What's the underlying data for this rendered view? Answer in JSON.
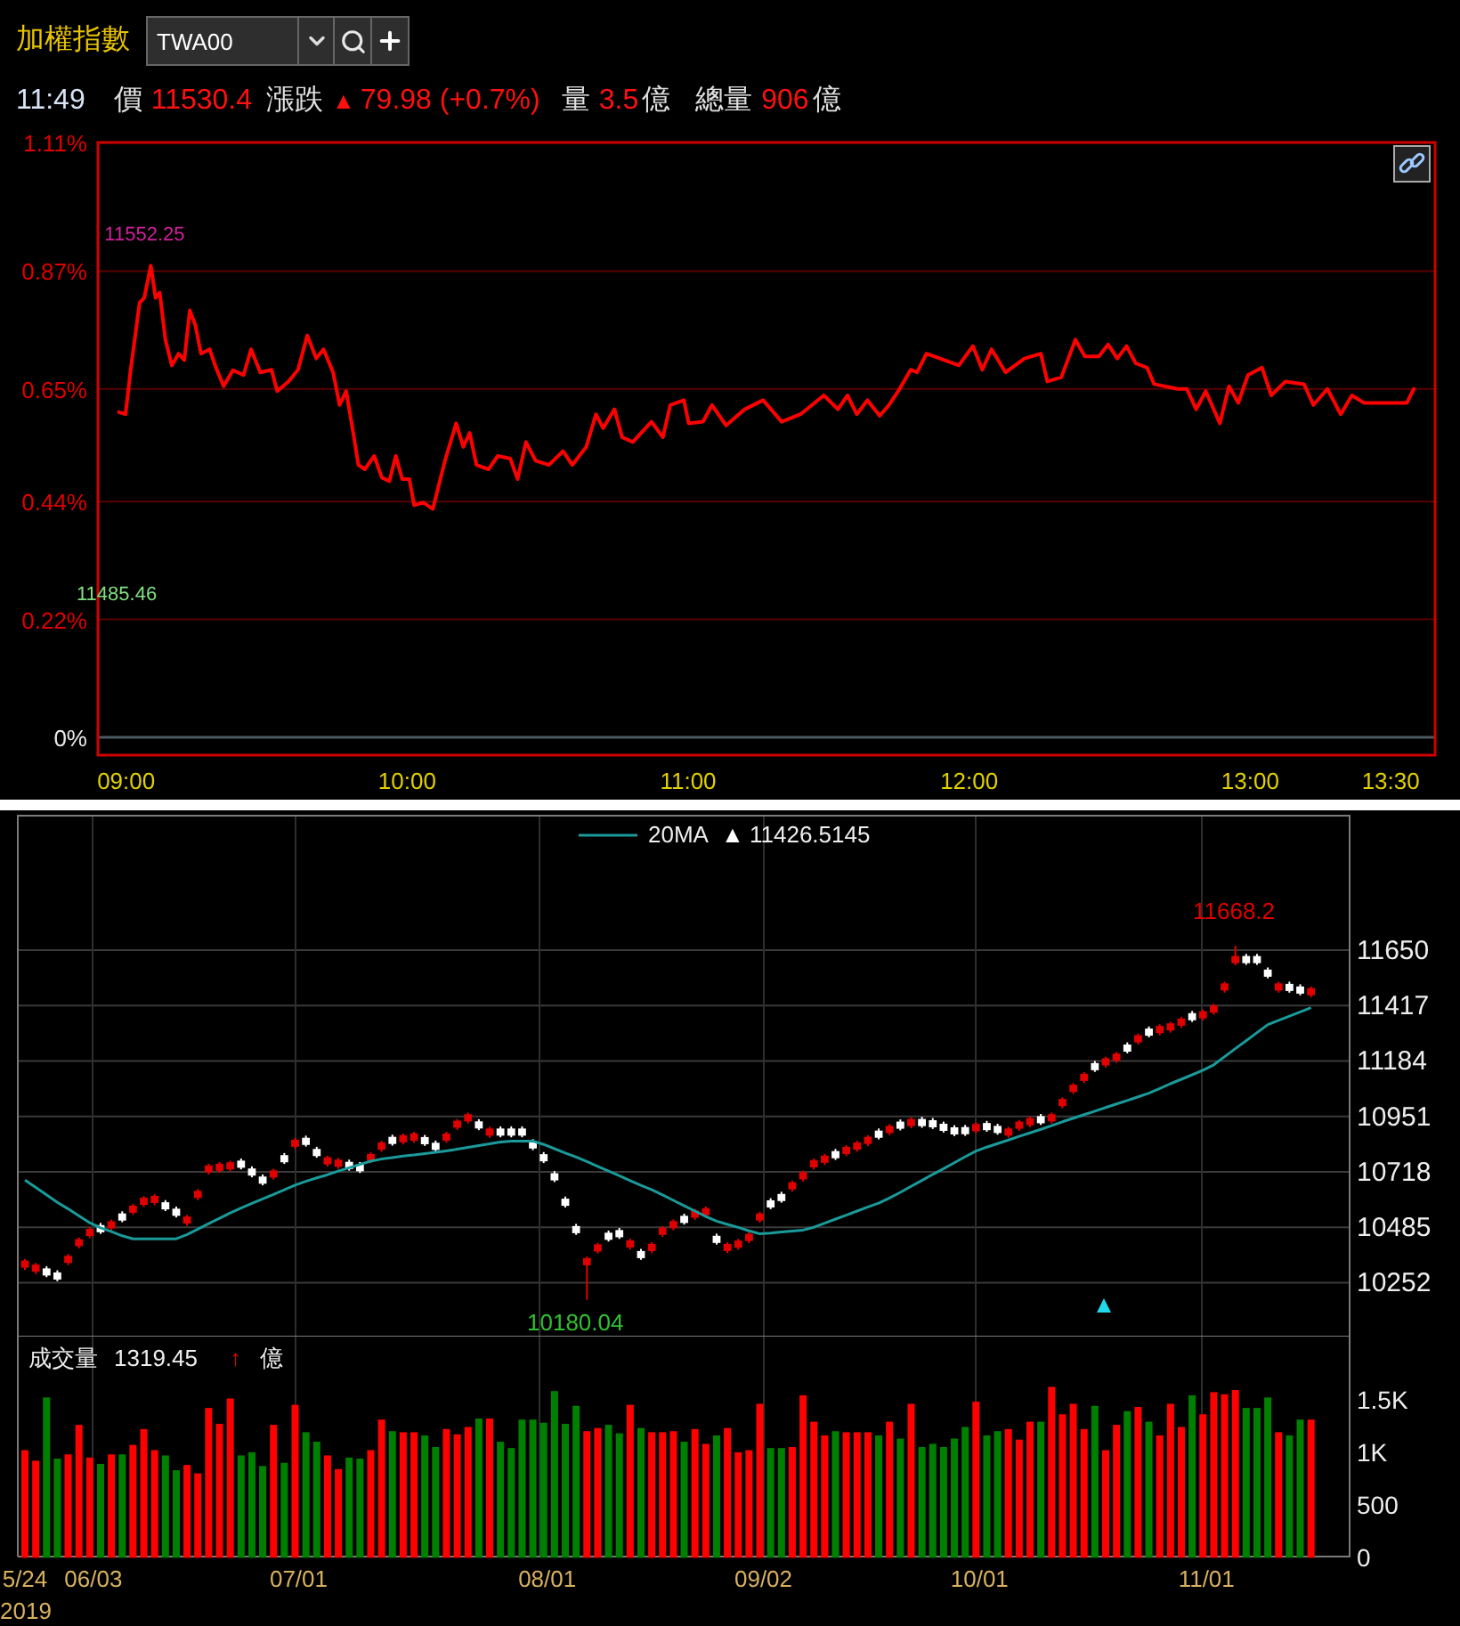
{
  "header": {
    "title": "加權指數",
    "symbol_field": {
      "value": "TWA00"
    }
  },
  "quote": {
    "time": "11:49",
    "price_label": "價",
    "price": "11530.4",
    "change_label": "漲跌",
    "change_arrow": "▲",
    "change": "79.98 (+0.7%)",
    "volume_label": "量",
    "volume": "3.5",
    "volume_unit": "億",
    "total_label": "總量",
    "total": "906",
    "total_unit": "億"
  },
  "intraday_chart": {
    "chart_data": {
      "type": "line",
      "grid": true,
      "xlim": [
        8.925,
        13.683
      ],
      "ylim": [
        0,
        1.11
      ],
      "xticks": [
        {
          "value": 9,
          "label": "09:00"
        },
        {
          "value": 10,
          "label": "10:00"
        },
        {
          "value": 11,
          "label": "11:00"
        },
        {
          "value": 12,
          "label": "12:00"
        },
        {
          "value": 13,
          "label": "13:00"
        },
        {
          "value": 13.5,
          "label": "13:30"
        }
      ],
      "yticks": [
        {
          "value": 0,
          "label": "0%"
        },
        {
          "value": 0.22,
          "label": "0.22%"
        },
        {
          "value": 0.44,
          "label": "0.44%"
        },
        {
          "value": 0.65,
          "label": "0.65%"
        },
        {
          "value": 0.87,
          "label": "0.87%"
        },
        {
          "value": 1.11,
          "label": "1.11%"
        }
      ],
      "x": [
        9,
        9.023,
        9.04,
        9.073,
        9.09,
        9.113,
        9.13,
        9.145,
        9.165,
        9.188,
        9.212,
        9.232,
        9.252,
        9.272,
        9.292,
        9.322,
        9.345,
        9.372,
        9.405,
        9.443,
        9.47,
        9.503,
        9.543,
        9.563,
        9.603,
        9.637,
        9.67,
        9.702,
        9.728,
        9.762,
        9.785,
        9.808,
        9.828,
        9.852,
        9.875,
        9.908,
        9.935,
        9.962,
        9.985,
        10.008,
        10.033,
        10.05,
        10.083,
        10.117,
        10.16,
        10.2,
        10.225,
        10.248,
        10.272,
        10.315,
        10.348,
        10.392,
        10.418,
        10.448,
        10.482,
        10.53,
        10.58,
        10.613,
        10.663,
        10.697,
        10.723,
        10.763,
        10.79,
        10.828,
        10.895,
        10.935,
        10.962,
        11.01,
        11.027,
        11.078,
        11.11,
        11.16,
        11.227,
        11.292,
        11.358,
        11.425,
        11.508,
        11.558,
        11.592,
        11.625,
        11.663,
        11.707,
        11.74,
        11.773,
        11.817,
        11.84,
        11.873,
        11.922,
        11.988,
        12.038,
        12.072,
        12.105,
        12.155,
        12.222,
        12.28,
        12.303,
        12.353,
        12.403,
        12.437,
        12.487,
        12.52,
        12.552,
        12.585,
        12.618,
        12.658,
        12.683,
        12.767,
        12.8,
        12.833,
        12.867,
        12.917,
        12.95,
        12.983,
        13.017,
        13.067,
        13.1,
        13.15,
        13.217,
        13.25,
        13.3,
        13.347,
        13.387,
        13.43,
        13.463,
        13.583,
        13.607
      ],
      "series": [
        {
          "color": "#ff0000",
          "values": [
            0.607,
            0.603,
            0.681,
            0.811,
            0.82,
            0.88,
            0.82,
            0.83,
            0.742,
            0.694,
            0.716,
            0.704,
            0.797,
            0.768,
            0.716,
            0.724,
            0.69,
            0.655,
            0.685,
            0.676,
            0.724,
            0.681,
            0.686,
            0.646,
            0.664,
            0.686,
            0.75,
            0.707,
            0.724,
            0.681,
            0.62,
            0.646,
            0.586,
            0.508,
            0.5,
            0.525,
            0.485,
            0.478,
            0.525,
            0.482,
            0.482,
            0.433,
            0.438,
            0.426,
            0.516,
            0.586,
            0.542,
            0.568,
            0.508,
            0.5,
            0.525,
            0.52,
            0.482,
            0.551,
            0.516,
            0.508,
            0.534,
            0.508,
            0.542,
            0.603,
            0.577,
            0.612,
            0.56,
            0.551,
            0.589,
            0.56,
            0.62,
            0.629,
            0.586,
            0.589,
            0.62,
            0.582,
            0.612,
            0.629,
            0.589,
            0.603,
            0.638,
            0.612,
            0.638,
            0.603,
            0.629,
            0.6,
            0.62,
            0.646,
            0.686,
            0.681,
            0.716,
            0.707,
            0.694,
            0.73,
            0.686,
            0.724,
            0.681,
            0.707,
            0.716,
            0.664,
            0.672,
            0.742,
            0.711,
            0.711,
            0.733,
            0.707,
            0.73,
            0.698,
            0.69,
            0.659,
            0.65,
            0.65,
            0.612,
            0.646,
            0.586,
            0.655,
            0.624,
            0.676,
            0.69,
            0.638,
            0.664,
            0.659,
            0.62,
            0.65,
            0.603,
            0.638,
            0.624,
            0.624,
            0.624,
            0.65
          ]
        }
      ],
      "annotations": [
        "11552.25",
        "11485.46"
      ]
    }
  },
  "daily_chart": {
    "legend": {
      "arrow": "▲",
      "value": "11426.5145"
    },
    "chart_data": {
      "type": "candlestick",
      "grid": true,
      "ylim": [
        10029,
        12215
      ],
      "ohlc": [
        [
          10315,
          10352,
          10306,
          10345
        ],
        [
          10298,
          10335,
          10289,
          10328
        ],
        [
          10312,
          10321,
          10275,
          10282
        ],
        [
          10295,
          10304,
          10258,
          10265
        ],
        [
          10335,
          10372,
          10326,
          10365
        ],
        [
          10405,
          10442,
          10396,
          10435
        ],
        [
          10448,
          10485,
          10439,
          10478
        ],
        [
          10494,
          10503,
          10457,
          10464
        ],
        [
          10480,
          10517,
          10471,
          10510
        ],
        [
          10543,
          10552,
          10506,
          10513
        ],
        [
          10546,
          10583,
          10537,
          10576
        ],
        [
          10579,
          10616,
          10570,
          10609
        ],
        [
          10587,
          10624,
          10578,
          10617
        ],
        [
          10590,
          10599,
          10553,
          10560
        ],
        [
          10563,
          10572,
          10526,
          10533
        ],
        [
          10500,
          10537,
          10491,
          10530
        ],
        [
          10608,
          10645,
          10599,
          10638
        ],
        [
          10715,
          10752,
          10706,
          10745
        ],
        [
          10722,
          10759,
          10713,
          10752
        ],
        [
          10728,
          10765,
          10719,
          10758
        ],
        [
          10765,
          10774,
          10728,
          10735
        ],
        [
          10732,
          10741,
          10695,
          10702
        ],
        [
          10698,
          10707,
          10661,
          10668
        ],
        [
          10694,
          10731,
          10685,
          10724
        ],
        [
          10788,
          10797,
          10751,
          10758
        ],
        [
          10823,
          10860,
          10814,
          10853
        ],
        [
          10861,
          10870,
          10824,
          10831
        ],
        [
          10814,
          10823,
          10777,
          10784
        ],
        [
          10749,
          10786,
          10740,
          10779
        ],
        [
          10739,
          10776,
          10730,
          10769
        ],
        [
          10760,
          10769,
          10723,
          10730
        ],
        [
          10750,
          10759,
          10713,
          10720
        ],
        [
          10763,
          10800,
          10754,
          10793
        ],
        [
          10811,
          10848,
          10802,
          10841
        ],
        [
          10865,
          10874,
          10828,
          10835
        ],
        [
          10842,
          10879,
          10833,
          10872
        ],
        [
          10849,
          10886,
          10840,
          10879
        ],
        [
          10864,
          10873,
          10827,
          10834
        ],
        [
          10840,
          10849,
          10803,
          10810
        ],
        [
          10849,
          10886,
          10840,
          10879
        ],
        [
          10903,
          10940,
          10894,
          10933
        ],
        [
          10930,
          10967,
          10921,
          10960
        ],
        [
          10930,
          10939,
          10893,
          10900
        ],
        [
          10870,
          10907,
          10861,
          10900
        ],
        [
          10900,
          10909,
          10863,
          10870
        ],
        [
          10900,
          10909,
          10863,
          10870
        ],
        [
          10900,
          10909,
          10863,
          10870
        ],
        [
          10846,
          10855,
          10809,
          10816
        ],
        [
          10792,
          10801,
          10755,
          10762
        ],
        [
          10712,
          10721,
          10675,
          10682
        ],
        [
          10605,
          10614,
          10568,
          10575
        ],
        [
          10490,
          10499,
          10453,
          10460
        ],
        [
          10325,
          10362,
          10180,
          10355
        ],
        [
          10383,
          10420,
          10374,
          10413
        ],
        [
          10462,
          10471,
          10425,
          10432
        ],
        [
          10473,
          10482,
          10436,
          10443
        ],
        [
          10400,
          10437,
          10391,
          10430
        ],
        [
          10385,
          10394,
          10348,
          10355
        ],
        [
          10385,
          10422,
          10376,
          10415
        ],
        [
          10453,
          10490,
          10444,
          10483
        ],
        [
          10481,
          10518,
          10472,
          10511
        ],
        [
          10533,
          10542,
          10496,
          10503
        ],
        [
          10525,
          10562,
          10516,
          10555
        ],
        [
          10535,
          10572,
          10526,
          10565
        ],
        [
          10449,
          10458,
          10412,
          10419
        ],
        [
          10385,
          10422,
          10376,
          10415
        ],
        [
          10399,
          10436,
          10390,
          10429
        ],
        [
          10427,
          10464,
          10418,
          10457
        ],
        [
          10513,
          10550,
          10504,
          10543
        ],
        [
          10598,
          10607,
          10561,
          10568
        ],
        [
          10625,
          10634,
          10588,
          10595
        ],
        [
          10644,
          10681,
          10635,
          10674
        ],
        [
          10686,
          10723,
          10677,
          10716
        ],
        [
          10737,
          10774,
          10728,
          10767
        ],
        [
          10756,
          10793,
          10747,
          10786
        ],
        [
          10805,
          10814,
          10768,
          10775
        ],
        [
          10793,
          10830,
          10784,
          10823
        ],
        [
          10811,
          10848,
          10802,
          10841
        ],
        [
          10835,
          10872,
          10826,
          10865
        ],
        [
          10891,
          10900,
          10854,
          10861
        ],
        [
          10881,
          10918,
          10872,
          10911
        ],
        [
          10929,
          10938,
          10892,
          10899
        ],
        [
          10910,
          10947,
          10901,
          10940
        ],
        [
          10940,
          10949,
          10903,
          10910
        ],
        [
          10935,
          10944,
          10898,
          10905
        ],
        [
          10920,
          10929,
          10883,
          10890
        ],
        [
          10905,
          10914,
          10868,
          10875
        ],
        [
          10906,
          10915,
          10869,
          10876
        ],
        [
          10889,
          10926,
          10880,
          10919
        ],
        [
          10923,
          10932,
          10886,
          10893
        ],
        [
          10911,
          10920,
          10874,
          10881
        ],
        [
          10870,
          10907,
          10861,
          10900
        ],
        [
          10899,
          10936,
          10890,
          10929
        ],
        [
          10914,
          10951,
          10905,
          10944
        ],
        [
          10952,
          10961,
          10915,
          10922
        ],
        [
          10930,
          10967,
          10921,
          10960
        ],
        [
          10994,
          11031,
          10985,
          11024
        ],
        [
          11054,
          11091,
          11045,
          11084
        ],
        [
          11100,
          11137,
          11091,
          11130
        ],
        [
          11175,
          11184,
          11138,
          11145
        ],
        [
          11165,
          11202,
          11156,
          11195
        ],
        [
          11185,
          11222,
          11176,
          11215
        ],
        [
          11253,
          11262,
          11216,
          11223
        ],
        [
          11262,
          11299,
          11253,
          11292
        ],
        [
          11320,
          11329,
          11283,
          11290
        ],
        [
          11301,
          11338,
          11292,
          11331
        ],
        [
          11312,
          11349,
          11303,
          11342
        ],
        [
          11332,
          11369,
          11323,
          11362
        ],
        [
          11385,
          11394,
          11348,
          11355
        ],
        [
          11363,
          11400,
          11354,
          11393
        ],
        [
          11387,
          11424,
          11378,
          11417
        ],
        [
          11480,
          11517,
          11471,
          11510
        ],
        [
          11595,
          11668,
          11586,
          11625
        ],
        [
          11625,
          11634,
          11588,
          11595
        ],
        [
          11625,
          11634,
          11588,
          11595
        ],
        [
          11568,
          11577,
          11531,
          11538
        ],
        [
          11480,
          11517,
          11471,
          11510
        ],
        [
          11508,
          11517,
          11471,
          11478
        ],
        [
          11497,
          11506,
          11460,
          11467
        ],
        [
          11460,
          11497,
          11451,
          11490
        ]
      ],
      "yticks": [
        {
          "value": 11650,
          "label": "11650"
        },
        {
          "value": 11417,
          "label": "11417"
        },
        {
          "value": 11184,
          "label": "11184"
        },
        {
          "value": 10951,
          "label": "10951"
        },
        {
          "value": 10718,
          "label": "10718"
        },
        {
          "value": 10485,
          "label": "10485"
        },
        {
          "value": 10252,
          "label": "10252"
        }
      ],
      "categories": [
        null,
        null,
        null,
        null,
        null,
        null,
        null,
        null,
        null,
        null,
        null,
        null,
        null,
        null,
        null,
        null,
        null,
        null,
        null,
        null,
        null,
        null,
        null,
        null,
        null,
        null,
        null,
        null,
        null,
        null,
        null,
        null,
        null,
        null,
        null,
        null,
        null,
        null,
        null,
        null,
        null,
        null,
        null,
        null,
        null,
        null,
        null,
        null,
        null,
        null,
        null,
        null,
        null,
        null,
        null,
        null,
        null,
        null,
        null,
        null,
        null,
        null,
        null,
        null,
        null,
        null,
        null,
        null,
        null,
        null,
        null,
        null,
        null,
        null,
        null,
        null,
        null,
        null,
        null,
        null,
        null,
        null,
        null,
        null,
        null,
        null,
        null,
        null,
        null,
        null,
        null,
        null,
        null,
        null,
        null,
        null,
        null,
        null,
        null,
        null,
        null,
        null,
        null,
        null,
        null,
        null,
        null,
        null,
        null,
        null,
        null,
        null,
        null,
        null,
        null,
        null,
        null,
        null,
        null,
        null
      ],
      "series": [
        {
          "name": "20MA",
          "type": "line",
          "color": "#1a9a9a",
          "values": [
            10683,
            10652,
            10621,
            10590,
            10562,
            10533,
            10504,
            10483,
            10466,
            10449,
            10436,
            10436,
            10436,
            10436,
            10436,
            10454,
            10477,
            10500,
            10522,
            10545,
            10566,
            10585,
            10604,
            10623,
            10642,
            10662,
            10678,
            10692,
            10706,
            10721,
            10735,
            10749,
            10763,
            10772,
            10778,
            10784,
            10789,
            10795,
            10800,
            10806,
            10813,
            10820,
            10828,
            10835,
            10843,
            10847,
            10847,
            10847,
            10833,
            10815,
            10797,
            10780,
            10761,
            10741,
            10721,
            10701,
            10681,
            10661,
            10642,
            10621,
            10598,
            10575,
            10553,
            10530,
            10510,
            10497,
            10484,
            10470,
            10457,
            10460,
            10465,
            10469,
            10473,
            10485,
            10502,
            10519,
            10536,
            10553,
            10570,
            10586,
            10608,
            10632,
            10657,
            10682,
            10707,
            10731,
            10756,
            10781,
            10805,
            10822,
            10837,
            10852,
            10867,
            10882,
            10897,
            10912,
            10928,
            10943,
            10958,
            10973,
            10988,
            11003,
            11018,
            11033,
            11049,
            11068,
            11088,
            11107,
            11126,
            11145,
            11168,
            11202,
            11236,
            11269,
            11303,
            11337,
            11355,
            11372,
            11390,
            11408
          ]
        }
      ],
      "annotations": [
        "11668.2",
        "10180.04"
      ]
    }
  },
  "volume_chart": {
    "label": "成交量",
    "value": "1319.45",
    "arrow": "↑",
    "unit": "億",
    "year": "2019",
    "chart_data": {
      "type": "bar",
      "stacked": true,
      "ylim": [
        0,
        2105
      ],
      "yticks": [
        {
          "value": 0,
          "label": "0"
        },
        {
          "value": 500,
          "label": "500"
        },
        {
          "value": 1000,
          "label": "1K"
        },
        {
          "value": 1500,
          "label": "1.5K"
        }
      ],
      "categories": [
        "5/24",
        null,
        null,
        null,
        null,
        null,
        "06/03",
        null,
        null,
        null,
        null,
        null,
        null,
        null,
        null,
        null,
        null,
        null,
        null,
        null,
        null,
        null,
        null,
        null,
        null,
        "07/01",
        null,
        null,
        null,
        null,
        null,
        null,
        null,
        null,
        null,
        null,
        null,
        null,
        null,
        null,
        null,
        null,
        null,
        null,
        null,
        null,
        null,
        null,
        "08/01",
        null,
        null,
        null,
        null,
        null,
        null,
        null,
        null,
        null,
        null,
        null,
        null,
        null,
        null,
        null,
        null,
        null,
        null,
        null,
        "09/02",
        null,
        null,
        null,
        null,
        null,
        null,
        null,
        null,
        null,
        null,
        null,
        null,
        null,
        null,
        null,
        null,
        null,
        null,
        null,
        "10/01",
        null,
        null,
        null,
        null,
        null,
        null,
        null,
        null,
        null,
        null,
        null,
        null,
        null,
        null,
        null,
        null,
        null,
        null,
        null,
        null,
        "11/01",
        null,
        null,
        null,
        null,
        null,
        null,
        null,
        null,
        null,
        null
      ],
      "series": [
        {
          "color": "#ff0000",
          "values": [
            1020,
            920,
            null,
            null,
            980,
            1260,
            950,
            null,
            980,
            null,
            1070,
            1220,
            1020,
            null,
            null,
            880,
            800,
            1420,
            1270,
            1510,
            null,
            null,
            null,
            1260,
            null,
            1450,
            null,
            null,
            970,
            840,
            null,
            null,
            1020,
            1310,
            null,
            1190,
            1190,
            null,
            null,
            1220,
            1170,
            1240,
            null,
            1320,
            null,
            null,
            null,
            null,
            null,
            null,
            null,
            null,
            1200,
            1230,
            null,
            null,
            1450,
            null,
            1190,
            1190,
            1200,
            null,
            1220,
            1080,
            null,
            1230,
            1000,
            1020,
            1460,
            null,
            null,
            1050,
            1540,
            1290,
            1160,
            null,
            1190,
            1190,
            1190,
            null,
            1290,
            null,
            1460,
            null,
            null,
            null,
            null,
            null,
            1480,
            null,
            null,
            1220,
            1120,
            1290,
            null,
            1620,
            1360,
            1460,
            1220,
            null,
            1020,
            1260,
            null,
            1430,
            null,
            1160,
            1460,
            1240,
            null,
            1360,
            1570,
            1550,
            1590,
            null,
            null,
            null,
            1190,
            null,
            null,
            1310
          ]
        },
        {
          "color": "#008000",
          "values": [
            null,
            null,
            1520,
            940,
            null,
            null,
            null,
            890,
            null,
            980,
            null,
            null,
            null,
            970,
            830,
            null,
            null,
            null,
            null,
            null,
            970,
            1000,
            870,
            null,
            900,
            null,
            1190,
            1100,
            null,
            null,
            950,
            940,
            null,
            null,
            1200,
            null,
            null,
            1160,
            1050,
            null,
            null,
            null,
            1320,
            null,
            1100,
            1040,
            1310,
            1310,
            1280,
            1580,
            1270,
            1440,
            null,
            null,
            1260,
            1180,
            null,
            1230,
            null,
            null,
            null,
            1100,
            null,
            null,
            1160,
            null,
            null,
            null,
            null,
            1040,
            1040,
            null,
            null,
            null,
            null,
            1200,
            null,
            null,
            null,
            1160,
            null,
            1130,
            null,
            1050,
            1080,
            1050,
            1130,
            1240,
            null,
            1160,
            1200,
            null,
            null,
            null,
            1290,
            null,
            null,
            null,
            null,
            1440,
            null,
            null,
            1390,
            null,
            1290,
            null,
            null,
            null,
            1540,
            null,
            null,
            null,
            null,
            1420,
            1420,
            1520,
            null,
            1160,
            1310,
            null
          ]
        }
      ]
    }
  }
}
